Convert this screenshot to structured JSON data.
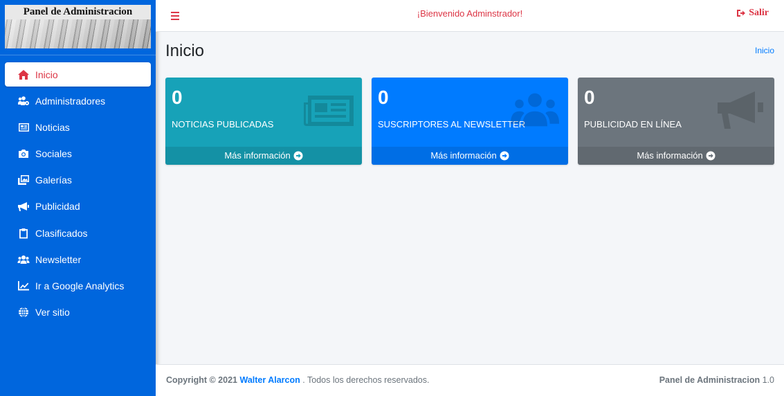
{
  "sidebar": {
    "brand_title": "Panel de Administracion",
    "items": [
      {
        "label": "Inicio",
        "icon": "home-icon",
        "active": true
      },
      {
        "label": "Administradores",
        "icon": "users-cog-icon"
      },
      {
        "label": "Noticias",
        "icon": "newspaper-icon"
      },
      {
        "label": "Sociales",
        "icon": "camera-icon"
      },
      {
        "label": "Galerías",
        "icon": "images-icon"
      },
      {
        "label": "Publicidad",
        "icon": "bullhorn-icon"
      },
      {
        "label": "Clasificados",
        "icon": "clipboard-icon"
      },
      {
        "label": "Newsletter",
        "icon": "users-icon"
      },
      {
        "label": "Ir a Google Analytics",
        "icon": "chart-line-icon"
      },
      {
        "label": "Ver sitio",
        "icon": "globe-icon"
      }
    ]
  },
  "header": {
    "welcome": "¡Bienvenido Adminstrador!",
    "logout_label": "Salir"
  },
  "main": {
    "title": "Inicio",
    "breadcrumb": "Inicio",
    "boxes": [
      {
        "count": "0",
        "label": "NOTICIAS PUBLICADAS",
        "more": "Más información",
        "color": "#17a2b8",
        "icon": "newspaper-icon"
      },
      {
        "count": "0",
        "label": "SUSCRIPTORES AL NEWSLETTER",
        "more": "Más información",
        "color": "#007bff",
        "icon": "users-icon"
      },
      {
        "count": "0",
        "label": "PUBLICIDAD EN LÍNEA",
        "more": "Más información",
        "color": "#6c757d",
        "icon": "bullhorn-icon"
      }
    ]
  },
  "footer": {
    "copyright": "Copyright © 2021",
    "author": "Walter Alarcon",
    "rights": ". Todos los derechos reservados.",
    "app_name": "Panel de Administracion",
    "version": "1.0"
  },
  "colors": {
    "sidebar": "#0066dd",
    "accent": "#dc3545",
    "link": "#007bff"
  }
}
